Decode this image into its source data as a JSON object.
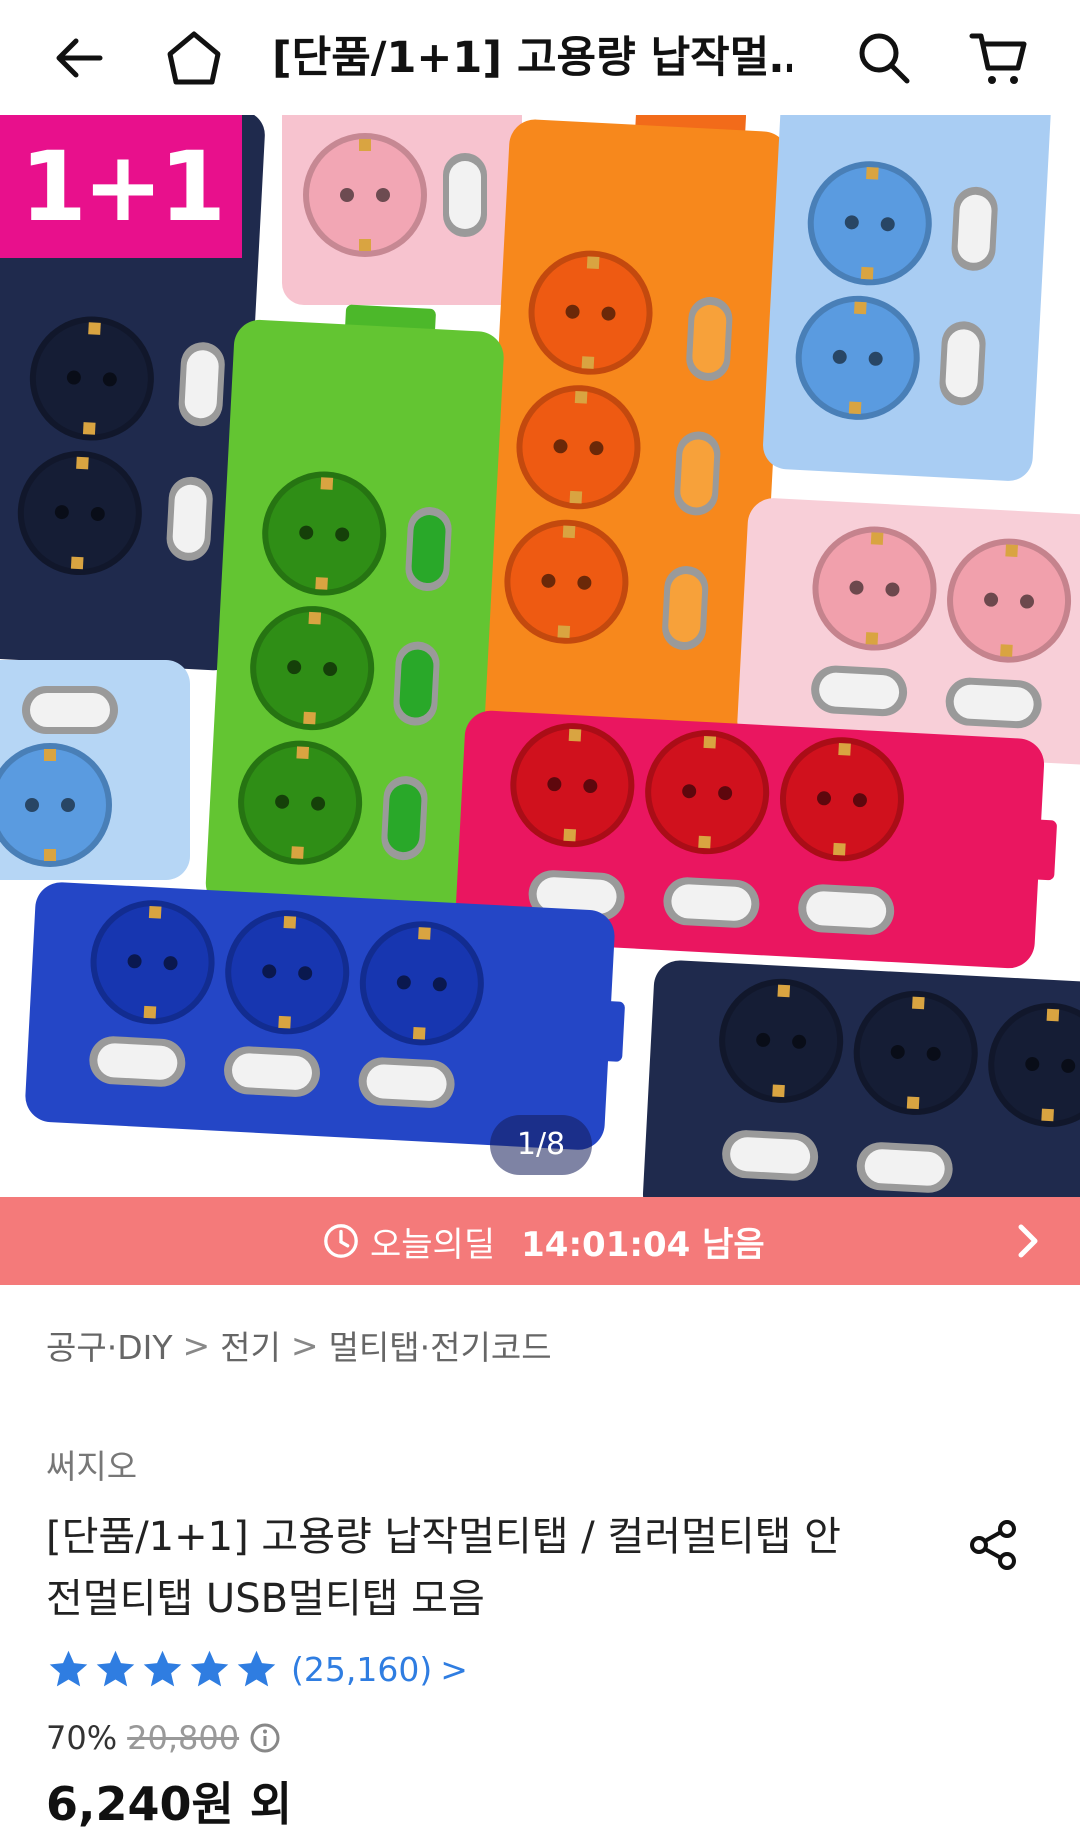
{
  "header": {
    "title": "[단품/1+1] 고용량 납작멀…"
  },
  "hero": {
    "badge": "1+1",
    "counter": "1/8"
  },
  "deal": {
    "label": "오늘의딜",
    "time": "14:01:04 남음"
  },
  "breadcrumb": {
    "items": [
      "공구·DIY",
      "전기",
      "멀티탭·전기코드"
    ],
    "sep": ">"
  },
  "product": {
    "brand": "써지오",
    "title": "[단품/1+1] 고용량 납작멀티탭 / 컬러멀티탭 안전멀티탭 USB멀티탭 모음",
    "rating_value": 5,
    "rating_max": 5,
    "review_count": "(25,160)",
    "review_chevron": ">",
    "discount": "70%",
    "original_price": "20,800",
    "price": "6,240원 외"
  },
  "colors": {
    "badge": "#e8108c",
    "deal_bar": "#f47a7a",
    "star": "#2f7de1",
    "link": "#2f7de1"
  },
  "icons": [
    "back-arrow-icon",
    "home-icon",
    "search-icon",
    "cart-icon",
    "clock-icon",
    "chevron-right-icon",
    "share-icon",
    "star-icon",
    "info-icon"
  ]
}
